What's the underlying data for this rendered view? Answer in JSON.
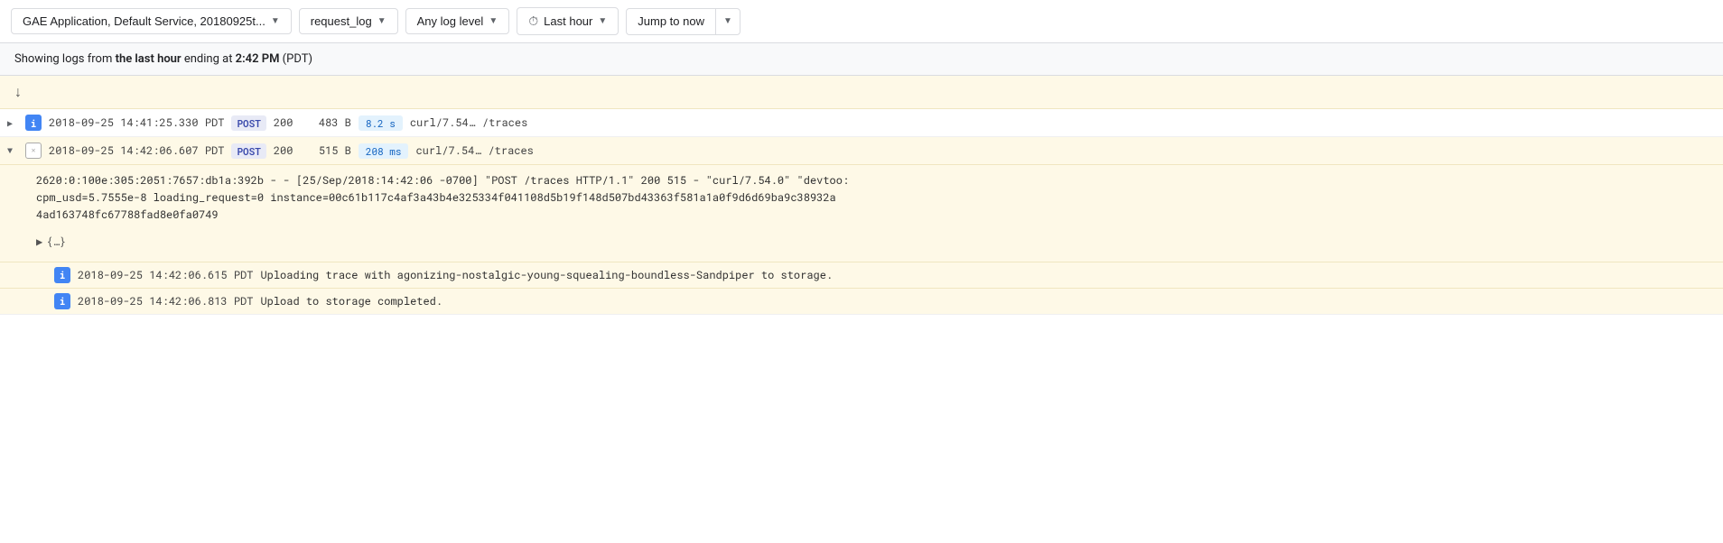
{
  "toolbar": {
    "resource_selector": {
      "label": "GAE Application, Default Service, 20180925t...",
      "aria": "resource-selector"
    },
    "log_type_selector": {
      "label": "request_log"
    },
    "log_level_selector": {
      "label": "Any log level"
    },
    "time_range_selector": {
      "label": "Last hour",
      "has_clock": true
    },
    "jump_to_now": {
      "label": "Jump to now"
    }
  },
  "info_bar": {
    "prefix": "Showing logs from ",
    "bold1": "the last hour",
    "middle": " ending at ",
    "bold2": "2:42 PM",
    "suffix": " (PDT)"
  },
  "timestamp_arrow": "↓",
  "log_entries": [
    {
      "id": "entry1",
      "expanded": false,
      "severity": "info",
      "severity_label": "i",
      "timestamp": "2018-09-25 14:41:25.330 PDT",
      "method": "POST",
      "status": "200",
      "size": "483 B",
      "latency": "8.2 s",
      "user_agent": "curl/7.54...",
      "path": "/traces"
    },
    {
      "id": "entry2",
      "expanded": true,
      "severity": "default",
      "severity_label": "×",
      "timestamp": "2018-09-25 14:42:06.607 PDT",
      "method": "POST",
      "status": "200",
      "size": "515 B",
      "latency": "208 ms",
      "user_agent": "curl/7.54...",
      "path": "/traces",
      "raw_log": "2620:0:100e:305:2051:7657:db1a:392b - - [25/Sep/2018:14:42:06 -0700] \"POST /traces HTTP/1.1\" 200 515 - \"curl/7.54.0\" \"devtoo:\ncpm_usd=5.7555e-8 loading_request=0 instance=00c61b117c4af3a43b4e325334f041108d5b19f148d507bd43363f581a1a0f9d6d69ba9c38932a \n4ad163748fc67788fad8e0fa0749",
      "json_toggle": "▶ {…}",
      "sub_logs": [
        {
          "severity": "info",
          "severity_label": "i",
          "timestamp": "2018-09-25 14:42:06.615 PDT",
          "message": "Uploading trace with agonizing-nostalgic-young-squealing-boundless-Sandpiper to storage."
        },
        {
          "severity": "info",
          "severity_label": "i",
          "timestamp": "2018-09-25 14:42:06.813 PDT",
          "message": "Upload to storage completed."
        }
      ]
    }
  ]
}
